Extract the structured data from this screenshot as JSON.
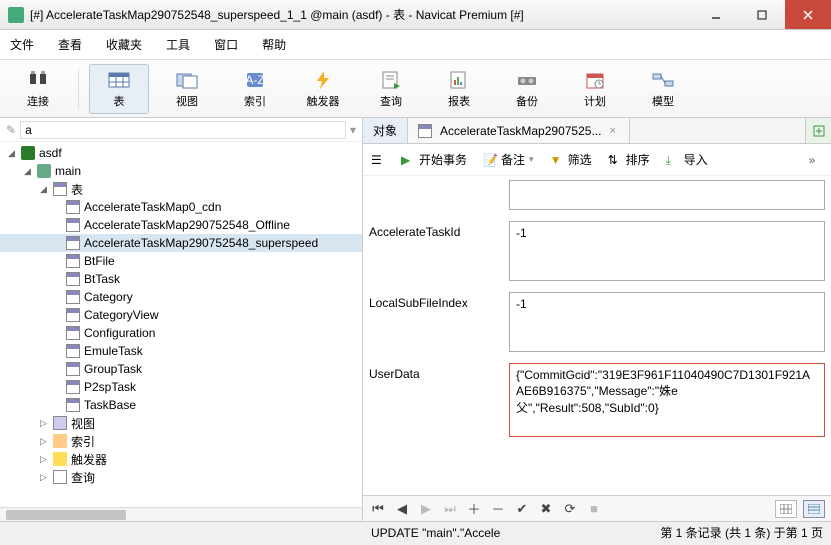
{
  "window": {
    "title": "[#] AccelerateTaskMap290752548_superspeed_1_1 @main (asdf) - 表 - Navicat Premium [#]"
  },
  "menu": [
    "文件",
    "查看",
    "收藏夹",
    "工具",
    "窗口",
    "帮助"
  ],
  "toolbar": [
    {
      "label": "连接",
      "icon": "plug"
    },
    {
      "label": "表",
      "icon": "table",
      "selected": true
    },
    {
      "label": "视图",
      "icon": "view"
    },
    {
      "label": "索引",
      "icon": "index"
    },
    {
      "label": "触发器",
      "icon": "trigger"
    },
    {
      "label": "查询",
      "icon": "query"
    },
    {
      "label": "报表",
      "icon": "report"
    },
    {
      "label": "备份",
      "icon": "backup"
    },
    {
      "label": "计划",
      "icon": "schedule"
    },
    {
      "label": "模型",
      "icon": "model"
    }
  ],
  "tree": {
    "connection": "a",
    "db": "asdf",
    "schema": "main",
    "folders": {
      "tables": "表",
      "views": "视图",
      "indexes": "索引",
      "triggers": "触发器",
      "queries": "查询"
    },
    "tables": [
      "AccelerateTaskMap0_cdn",
      "AccelerateTaskMap290752548_Offline",
      "AccelerateTaskMap290752548_superspeed",
      "BtFile",
      "BtTask",
      "Category",
      "CategoryView",
      "Configuration",
      "EmuleTask",
      "GroupTask",
      "P2spTask",
      "TaskBase"
    ],
    "selected_table_index": 2
  },
  "tabs": [
    {
      "label": "对象",
      "selected": true
    },
    {
      "label": "AccelerateTaskMap2907525...",
      "icon": "table"
    }
  ],
  "subbar": {
    "begin_tx": "开始事务",
    "memo": "备注",
    "filter": "筛选",
    "sort": "排序",
    "import": "导入"
  },
  "form": {
    "rows": [
      {
        "label": "",
        "value": ""
      },
      {
        "label": "AccelerateTaskId",
        "value": "-1"
      },
      {
        "label": "LocalSubFileIndex",
        "value": "-1"
      },
      {
        "label": "UserData",
        "value": "{\"CommitGcid\":\"319E3F961F11040490C7D1301F921AAE6B916375\",\"Message\":\"姝e父\",\"Result\":508,\"SubId\":0}",
        "highlight": true
      }
    ]
  },
  "status": {
    "left": "",
    "middle": "UPDATE \"main\".\"Accele",
    "right": "第 1 条记录 (共 1 条) 于第 1 页"
  }
}
